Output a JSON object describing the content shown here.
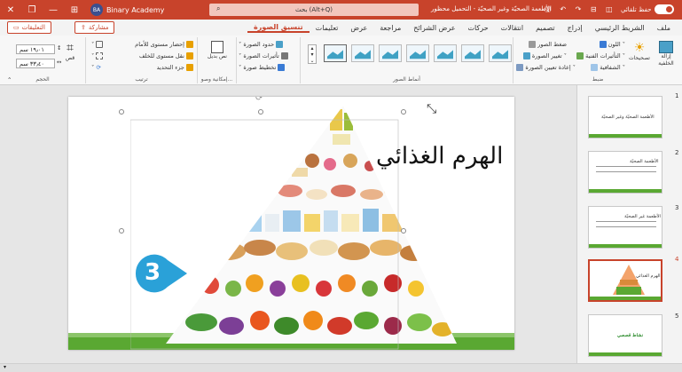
{
  "window": {
    "close": "✕",
    "restore": "❐",
    "minimize": "—",
    "ribbon_display": "⊞",
    "account_initials": "BA",
    "account_name": "Binary Academy",
    "search_text": "بحث (Alt+Q)",
    "doc_title": "الأطعمة الصحيّة وغير الصحيّة - التحميل محظور",
    "qat": "🖫 ↶ ↷ ⊟ ◫",
    "autosave_label": "حفظ تلقائي"
  },
  "tabs": [
    {
      "label": "ملف",
      "active": false
    },
    {
      "label": "الشريط الرئيسي",
      "active": false
    },
    {
      "label": "إدراج",
      "active": false
    },
    {
      "label": "تصميم",
      "active": false
    },
    {
      "label": "انتقالات",
      "active": false
    },
    {
      "label": "حركات",
      "active": false
    },
    {
      "label": "عرض الشرائح",
      "active": false
    },
    {
      "label": "مراجعة",
      "active": false
    },
    {
      "label": "عرض",
      "active": false
    },
    {
      "label": "تعليمات",
      "active": false
    },
    {
      "label": "تنسيق الصورة",
      "active": true
    }
  ],
  "share_label": "مشاركة",
  "comments_label": "التعليقات",
  "ribbon": {
    "adjust": {
      "label": "ضبط",
      "remove_bg": "إزالة الخلفية",
      "corrections": "تصحيحات",
      "color": "اللون",
      "artistic": "التأثيرات الفنية",
      "transparency": "الشفافية",
      "compress": "ضغط الصور",
      "change": "تغيير الصورة",
      "reset": "إعادة تعيين الصورة"
    },
    "styles": {
      "label": "أنماط الصور"
    },
    "picture": {
      "border": "حدود الصورة",
      "effects": "تأثيرات الصورة",
      "layout": "تخطيط صورة"
    },
    "accessibility": {
      "label": "إمكانية وصو...",
      "alt_text": "نص بديل"
    },
    "arrange": {
      "label": "ترتيب",
      "forward": "إحضار مستوى للأمام",
      "backward": "نقل مستوى للخلف",
      "pane": "جزء التحديد"
    },
    "size": {
      "label": "الحجم",
      "crop": "قص",
      "height": "١٩٫٠١ سم",
      "width": "٣٣٫٤٠ سم"
    }
  },
  "slide": {
    "title": "الهرم الغذائي",
    "badge": "3"
  },
  "thumbnails": [
    {
      "num": "1",
      "text": "الأطعمة الصحيّة وغير الصحيّة",
      "selected": false
    },
    {
      "num": "2",
      "text": "الأطعمة الصحيّة",
      "selected": false
    },
    {
      "num": "3",
      "text": "الأطعمة غير الصحيّة",
      "selected": false
    },
    {
      "num": "4",
      "text": "الهرم الغذائي",
      "selected": true
    },
    {
      "num": "5",
      "text": "نشاط قصصي",
      "selected": false
    }
  ],
  "colors": {
    "accent": "#c8432b",
    "green": "#5aa832",
    "badge": "#2aa1d8"
  }
}
